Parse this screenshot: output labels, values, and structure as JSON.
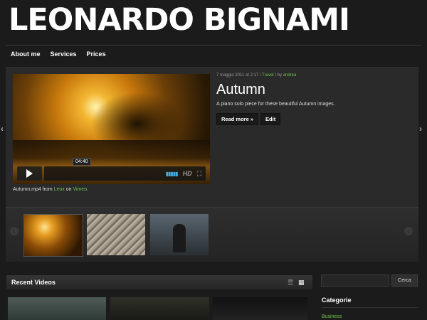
{
  "site": {
    "title": "LEONARDO BIGNAMI"
  },
  "nav": {
    "items": [
      "About me",
      "Services",
      "Prices"
    ]
  },
  "featured": {
    "time": "04:40",
    "hd_label": "HD",
    "caption": {
      "pre": "Autumn.mp4 from ",
      "user": "Leox",
      "mid": " on ",
      "site": "Vimeo",
      "end": "."
    },
    "meta": {
      "date": "7 maggio 2011 at 2:17 / ",
      "category": "Travel",
      "by": " / by ",
      "author": "andrea"
    },
    "title": "Autumn",
    "excerpt": "A piano solo piece for these beautiful Autumn images.",
    "read_more": "Read more »",
    "edit": "Edit"
  },
  "recent": {
    "title": "Recent Videos"
  },
  "sidebar": {
    "search_placeholder": "",
    "search_button": "Cerca",
    "categories_title": "Categorie",
    "categories": [
      "Business"
    ]
  },
  "colors": {
    "link_green": "#6fc64b",
    "accent_blue": "#43a8e0",
    "background": "#1b1b1b"
  }
}
